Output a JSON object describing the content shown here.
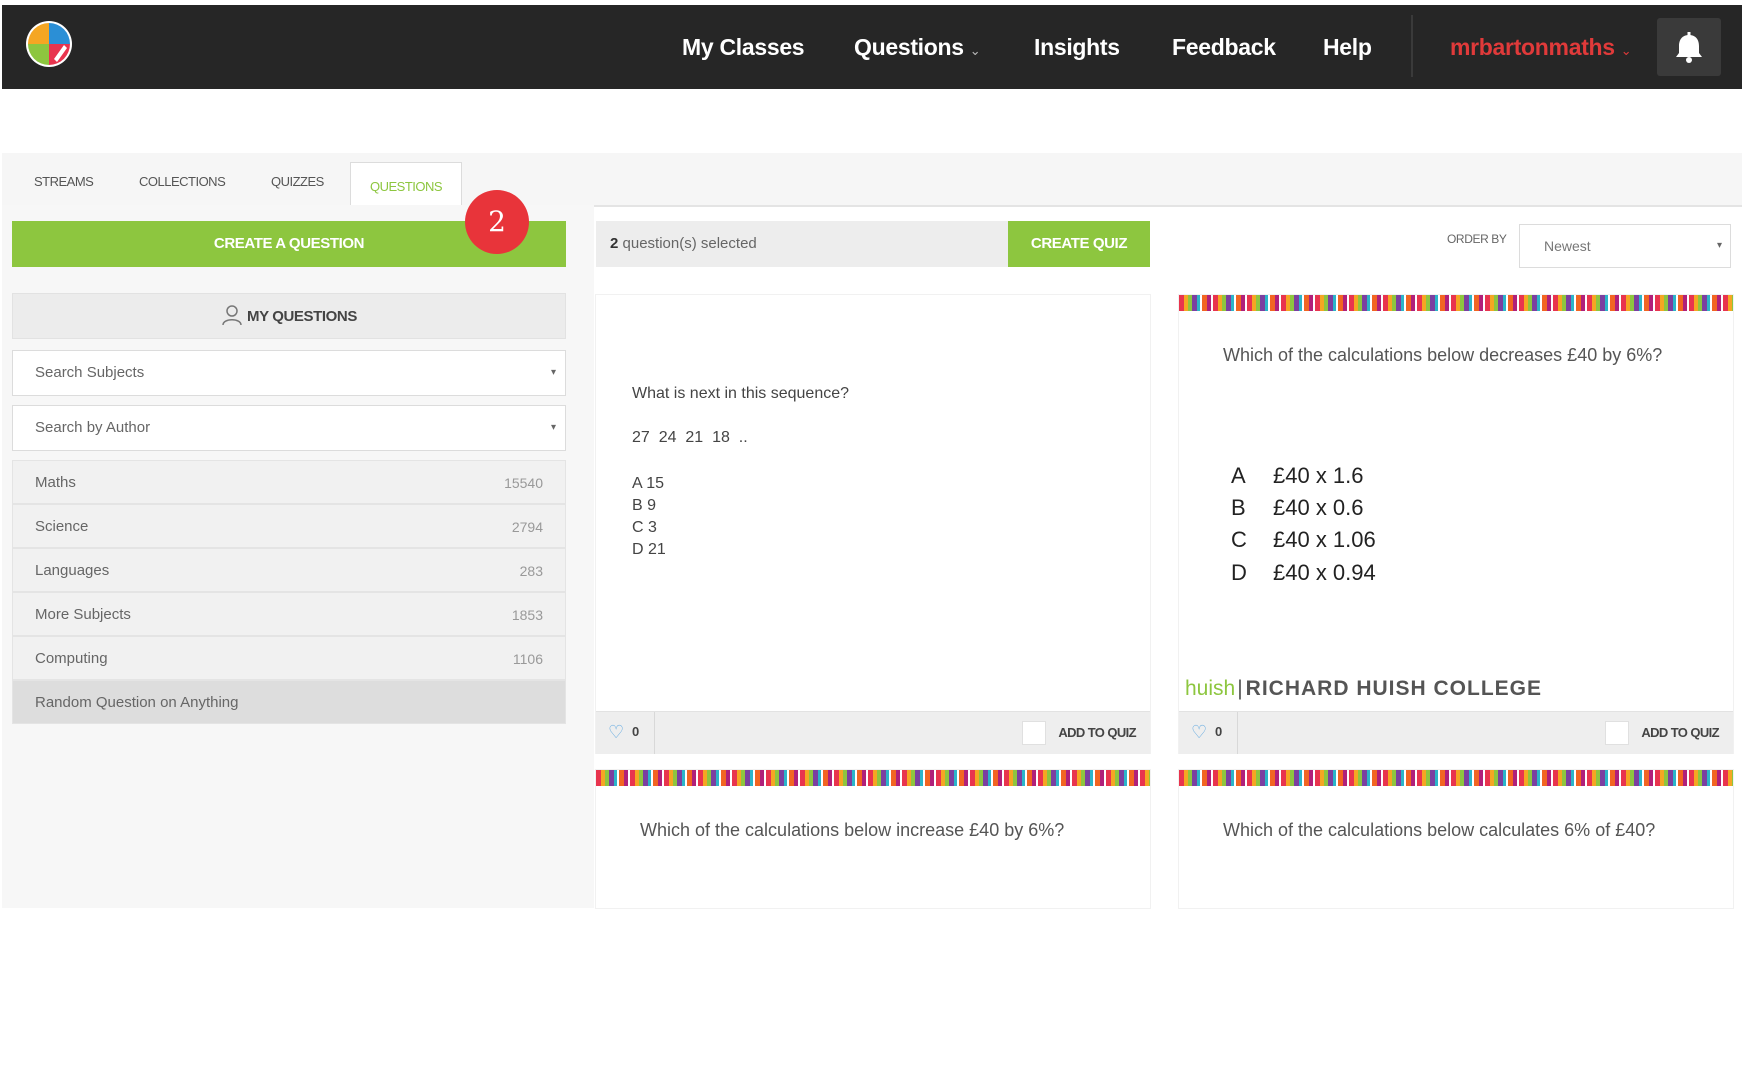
{
  "header": {
    "nav": [
      {
        "label": "My Classes"
      },
      {
        "label": "Questions"
      },
      {
        "label": "Insights"
      },
      {
        "label": "Feedback"
      },
      {
        "label": "Help"
      }
    ],
    "user": "mrbartonmaths",
    "colors": {
      "bar": "#262626",
      "user": "#e03a3a",
      "accent": "#8dc63f"
    }
  },
  "tabs": [
    "STREAMS",
    "COLLECTIONS",
    "QUIZZES",
    "QUESTIONS"
  ],
  "active_tab": "QUESTIONS",
  "step_badge": "2",
  "left": {
    "create_label": "CREATE A QUESTION",
    "my_questions_label": "MY QUESTIONS",
    "search_subjects_placeholder": "Search Subjects",
    "search_author_placeholder": "Search by Author",
    "subjects": [
      {
        "name": "Maths",
        "count": "15540"
      },
      {
        "name": "Science",
        "count": "2794"
      },
      {
        "name": "Languages",
        "count": "283"
      },
      {
        "name": "More Subjects",
        "count": "1853"
      },
      {
        "name": "Computing",
        "count": "1106"
      },
      {
        "name": "Random Question on Anything",
        "count": ""
      }
    ]
  },
  "selection": {
    "count": "2",
    "text": "question(s) selected",
    "create_quiz_label": "CREATE QUIZ"
  },
  "order": {
    "label": "ORDER BY",
    "value": "Newest"
  },
  "cards": {
    "sequence": {
      "question": "What is next in this sequence?",
      "sequence": "27  24  21  18  ..",
      "options": [
        "A 15",
        "B 9",
        "C 3",
        "D 21"
      ],
      "likes": "0",
      "add_label": "ADD TO QUIZ"
    },
    "decrease": {
      "question": "Which of the calculations below decreases £40 by 6%?",
      "options": [
        {
          "letter": "A",
          "text": "£40 x 1.6"
        },
        {
          "letter": "B",
          "text": "£40 x 0.6"
        },
        {
          "letter": "C",
          "text": "£40 x 1.06"
        },
        {
          "letter": "D",
          "text": "£40 x 0.94"
        }
      ],
      "college_short": "huish",
      "college": "RICHARD HUISH COLLEGE",
      "likes": "0",
      "add_label": "ADD TO QUIZ"
    },
    "increase": {
      "question": "Which of the calculations below increase £40 by 6%?"
    },
    "percent": {
      "question": "Which of the calculations below calculates 6% of £40?"
    }
  }
}
